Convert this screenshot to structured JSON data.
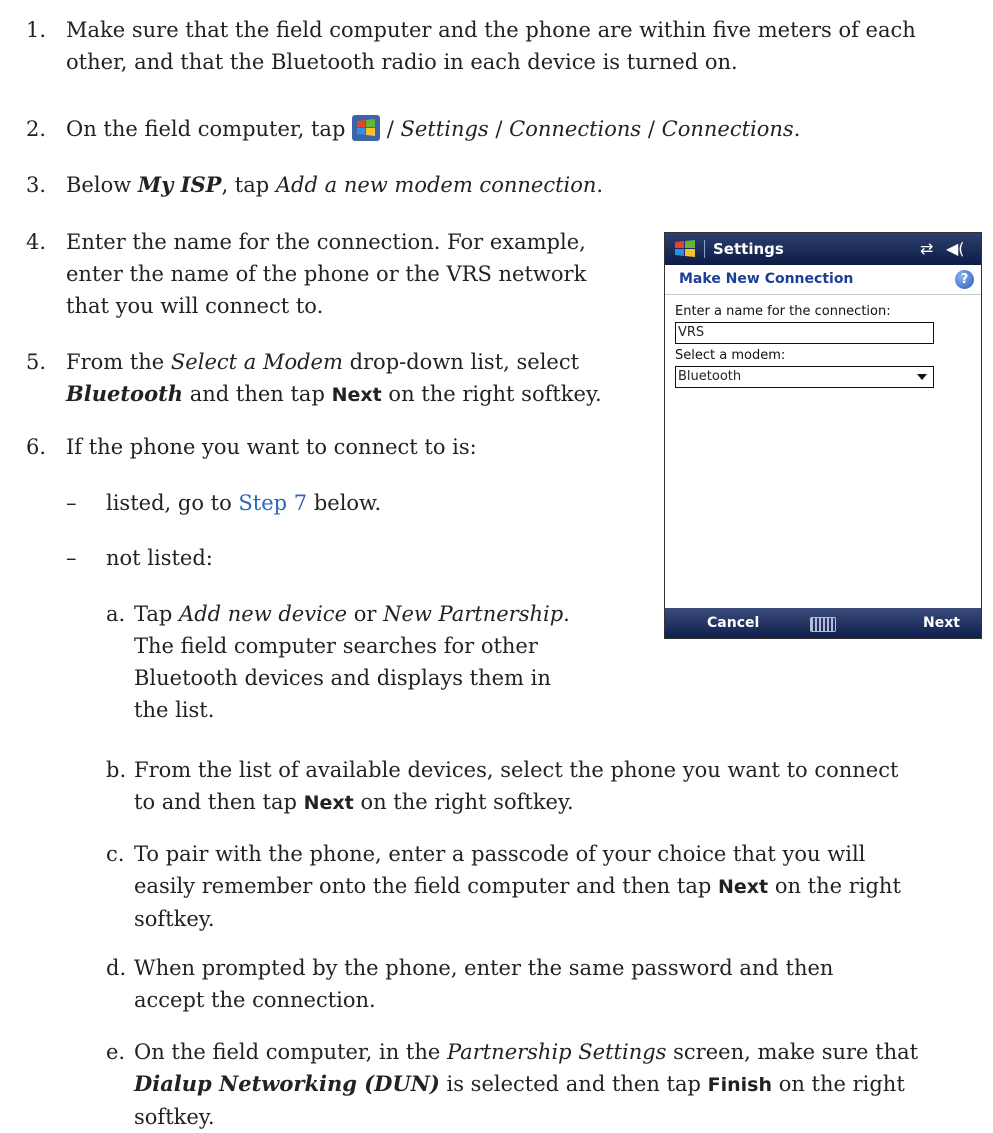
{
  "steps": [
    {
      "num": "1.",
      "line1": "Make sure that the field computer and the phone are within five meters of each",
      "line2": "other, and that the Bluetooth radio in each device is turned on."
    },
    {
      "num": "2.",
      "pre": "On the field computer, tap",
      "parts": [
        "Settings",
        "Connections",
        "Connections"
      ],
      "sep": " / "
    },
    {
      "num": "3.",
      "pre": "Below",
      "bold_italic": "My ISP",
      "mid": ", tap",
      "italic": "Add a new modem connection",
      "end": "."
    },
    {
      "num": "4.",
      "lines": [
        "Enter the name for the connection. For example,",
        "enter the name of the phone or the VRS network",
        "that you will connect to."
      ]
    },
    {
      "num": "5.",
      "pre": "From the",
      "italic": "Select a Modem",
      "post": "drop-down list, select",
      "bold_italic": "Bluetooth",
      "mid": "and then tap",
      "ui": "Next",
      "end": "on the right softkey."
    },
    {
      "num": "6.",
      "text": "If the phone you want to connect to is:"
    }
  ],
  "bullets": [
    {
      "dash": "–",
      "text": "listed, go to",
      "link": "Step 7",
      "end": "below."
    },
    {
      "dash": "–",
      "text": "not listed:"
    }
  ],
  "substeps": [
    {
      "letter": "a.",
      "pre": "Tap",
      "i1": "Add new device",
      "mid": "or",
      "i2": "New Partnership",
      "l1end": ".",
      "lines": [
        "The field computer searches for other",
        "Bluetooth devices and displays them in",
        "the list."
      ]
    },
    {
      "letter": "b.",
      "line1": "From the list of available devices, select the phone you want to connect",
      "pre2": "to and then tap",
      "ui": "Next",
      "end2": "on the right softkey."
    },
    {
      "letter": "c.",
      "line1": "To pair with the phone, enter a passcode of your choice that you will",
      "pre2": "easily remember onto the field computer and then tap",
      "ui": "Next",
      "end2": "on the right",
      "line3": "softkey."
    },
    {
      "letter": "d.",
      "line1": "When prompted by the phone, enter the same password and then",
      "line2": "accept the connection."
    },
    {
      "letter": "e.",
      "pre": "On the field computer, in the",
      "italic": "Partnership Settings",
      "post": "screen, make sure that",
      "bold_italic": "Dialup Networking (DUN)",
      "mid": "is selected and then tap",
      "ui": "Finish",
      "end": "on the right",
      "line3": "softkey."
    }
  ],
  "phone": {
    "title": "Settings",
    "status_icons": [
      "connectivity-icon",
      "speaker-icon"
    ],
    "heading": "Make New Connection",
    "help": "?",
    "name_label": "Enter a name for the connection:",
    "name_value": "VRS",
    "modem_label": "Select a modem:",
    "modem_value": "Bluetooth",
    "softkey_left": "Cancel",
    "softkey_right": "Next"
  },
  "colors": {
    "link": "#2b67b8",
    "phone_bar": "#0b1c47",
    "phone_heading": "#1c3f95"
  }
}
